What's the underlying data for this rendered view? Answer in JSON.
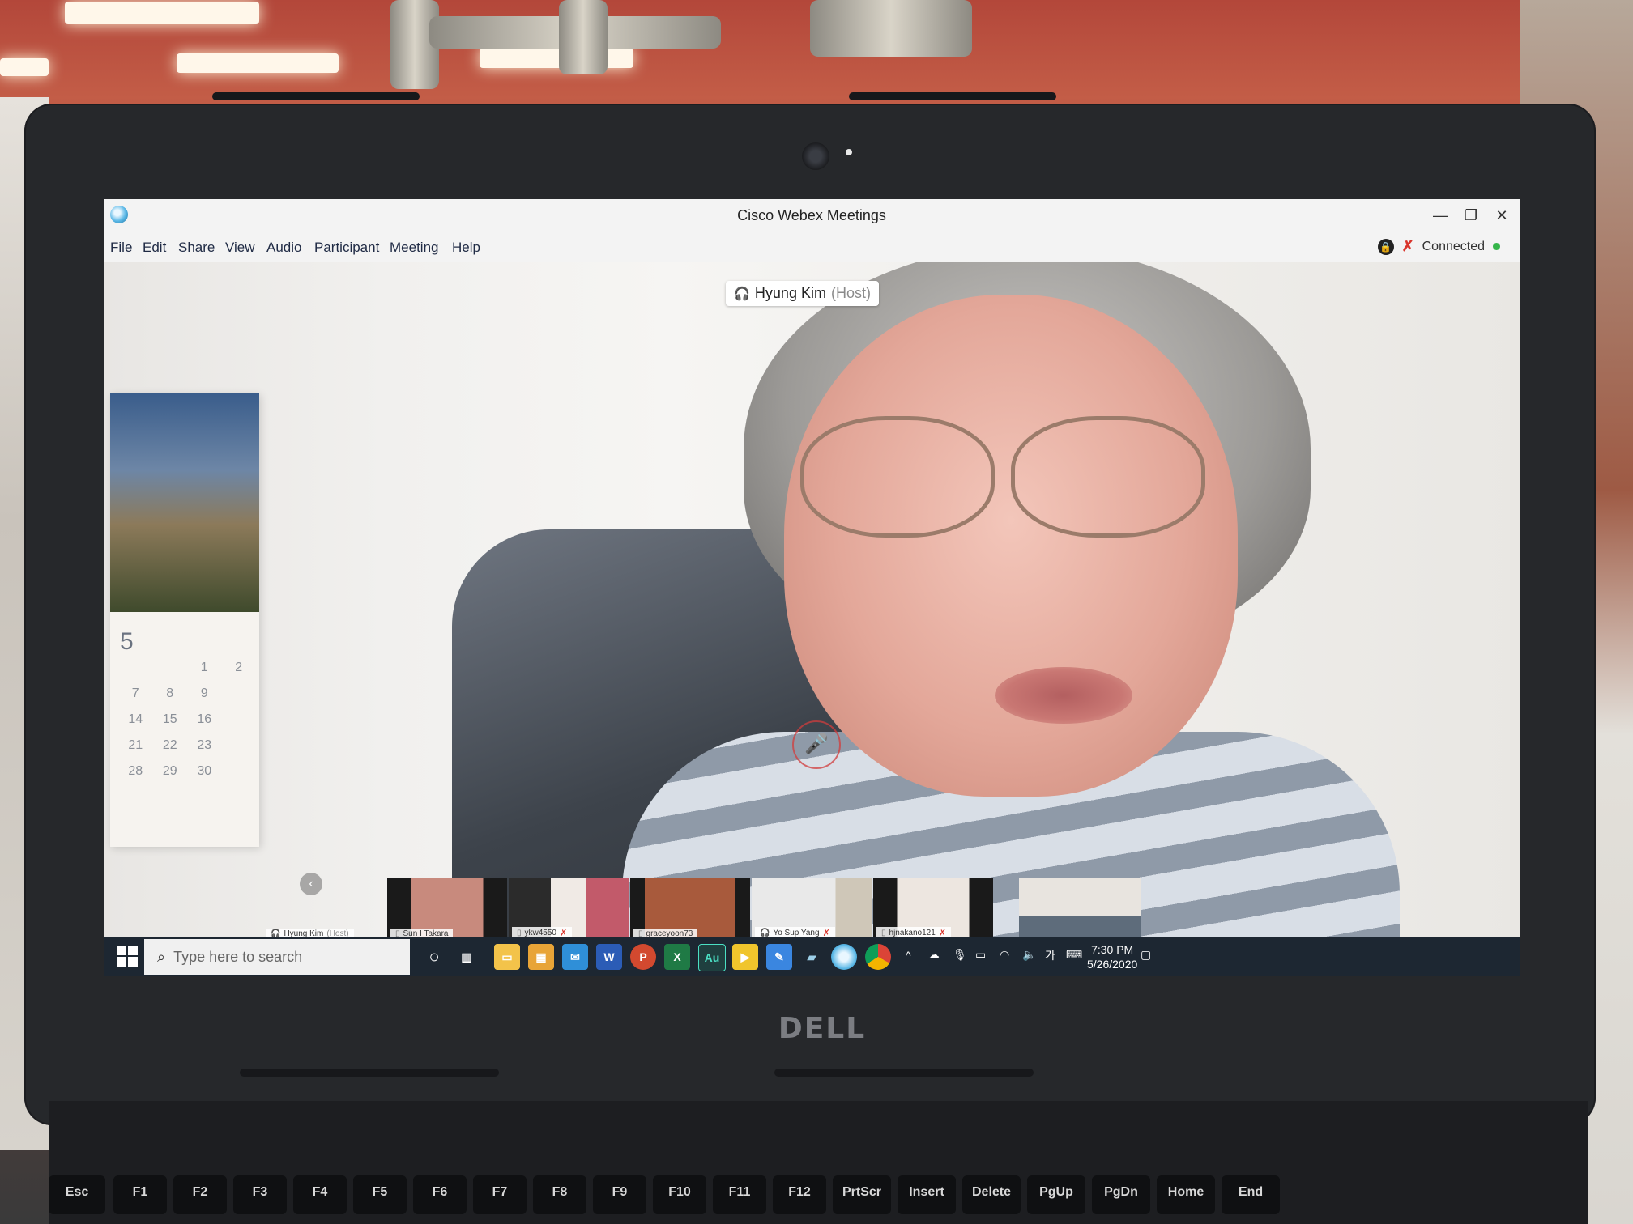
{
  "window": {
    "title": "Cisco Webex Meetings",
    "minimize": "—",
    "restore": "❐",
    "close": "✕"
  },
  "menu": {
    "items": [
      "File",
      "Edit",
      "Share",
      "View",
      "Audio",
      "Participant",
      "Meeting",
      "Help"
    ]
  },
  "status": {
    "connection": "Connected",
    "connected_color": "#35b54a"
  },
  "active_speaker": {
    "name": "Hyung Kim",
    "role": "(Host)"
  },
  "calendar": {
    "month": "5",
    "days": [
      "1",
      "2",
      "7",
      "8",
      "9",
      "14",
      "15",
      "16",
      "21",
      "22",
      "23",
      "28",
      "29",
      "30"
    ]
  },
  "participants": [
    {
      "name": "Hyung Kim",
      "role": "(Host)"
    },
    {
      "name": "Sun I Takara"
    },
    {
      "name": "ykw4550"
    },
    {
      "name": "graceyoon73"
    },
    {
      "name": "Yo Sup Yang"
    },
    {
      "name": "hjnakano121"
    },
    {
      "name": ""
    }
  ],
  "taskbar": {
    "search_placeholder": "Type here to search",
    "time": "7:30 PM",
    "date": "5/26/2020",
    "ime": "가",
    "apps": [
      "Au"
    ]
  },
  "laptop": {
    "brand": "DELL",
    "keys": [
      "Esc",
      "F1",
      "F2",
      "F3",
      "F4",
      "F5",
      "F6",
      "F7",
      "F8",
      "F9",
      "F10",
      "F11",
      "F12",
      "PrtScr",
      "Insert",
      "Delete",
      "PgUp",
      "PgDn",
      "Home",
      "End"
    ]
  }
}
